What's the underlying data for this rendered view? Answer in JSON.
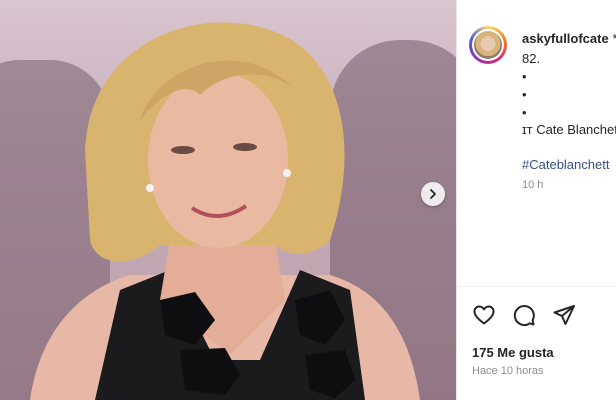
{
  "post": {
    "username": "askyfullofcate",
    "username_suffix": " *",
    "caption_lines": [
      "82.",
      "•",
      "•",
      "•",
      "ɪт Cate Blanchett"
    ],
    "hashtag": "#Cateblanchett",
    "age": "10 h"
  },
  "actions": {
    "like_icon": "heart-icon",
    "comment_icon": "comment-icon",
    "share_icon": "send-icon"
  },
  "likes_label": "175 Me gusta",
  "posted_label": "Hace 10 horas",
  "carousel": {
    "next_icon": "chevron-right-icon"
  }
}
